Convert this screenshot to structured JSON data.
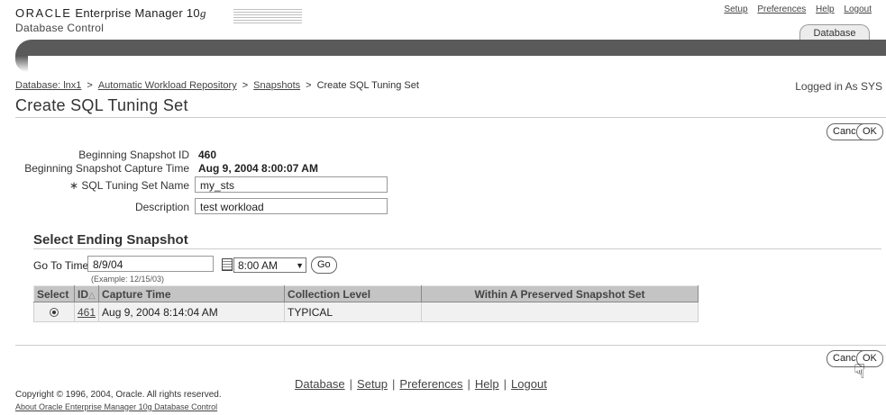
{
  "header": {
    "brand_oracle": "ORACLE",
    "brand_product": "Enterprise Manager 10",
    "brand_version": "g",
    "subtitle": "Database Control",
    "global_links": [
      "Setup",
      "Preferences",
      "Help",
      "Logout"
    ],
    "tab": "Database"
  },
  "breadcrumb": [
    "Database: lnx1",
    "Automatic Workload Repository",
    "Snapshots",
    "Create SQL Tuning Set"
  ],
  "breadcrumb_sep": ">",
  "logged_in": "Logged in As SYS",
  "page_title": "Create SQL Tuning Set",
  "buttons": {
    "cancel": "Cancel",
    "ok": "OK",
    "go": "Go"
  },
  "form": {
    "begin_snapshot_label": "Beginning Snapshot ID",
    "begin_snapshot_value": "460",
    "capture_time_label": "Beginning Snapshot Capture Time",
    "capture_time_value": "Aug 9, 2004 8:00:07 AM",
    "sts_name_label": "∗ SQL Tuning Set Name",
    "sts_name_value": "my_sts",
    "description_label": "Description",
    "description_value": "test workload"
  },
  "ending_section": {
    "heading": "Select Ending Snapshot",
    "goto_label": "Go To Time",
    "date_value": "8/9/04",
    "date_example": "(Example: 12/15/03)",
    "time_value": "8:00 AM"
  },
  "table": {
    "headers": [
      "Select",
      "ID",
      "Capture Time",
      "Collection Level",
      "Within A Preserved Snapshot Set"
    ],
    "sort_indicator": "△",
    "rows": [
      {
        "id": "461",
        "capture_time": "Aug 9, 2004 8:14:04 AM",
        "collection_level": "TYPICAL",
        "preserved": ""
      }
    ]
  },
  "footer": {
    "links": [
      "Database",
      "Setup",
      "Preferences",
      "Help",
      "Logout"
    ],
    "separator": "|",
    "copyright": "Copyright © 1996, 2004, Oracle. All rights reserved.",
    "about": "About Oracle Enterprise Manager 10g Database Control"
  },
  "icons": {
    "calendar": "calendar-icon",
    "dropdown": "chevron-down-icon",
    "cursor": "hand-pointer-icon"
  }
}
